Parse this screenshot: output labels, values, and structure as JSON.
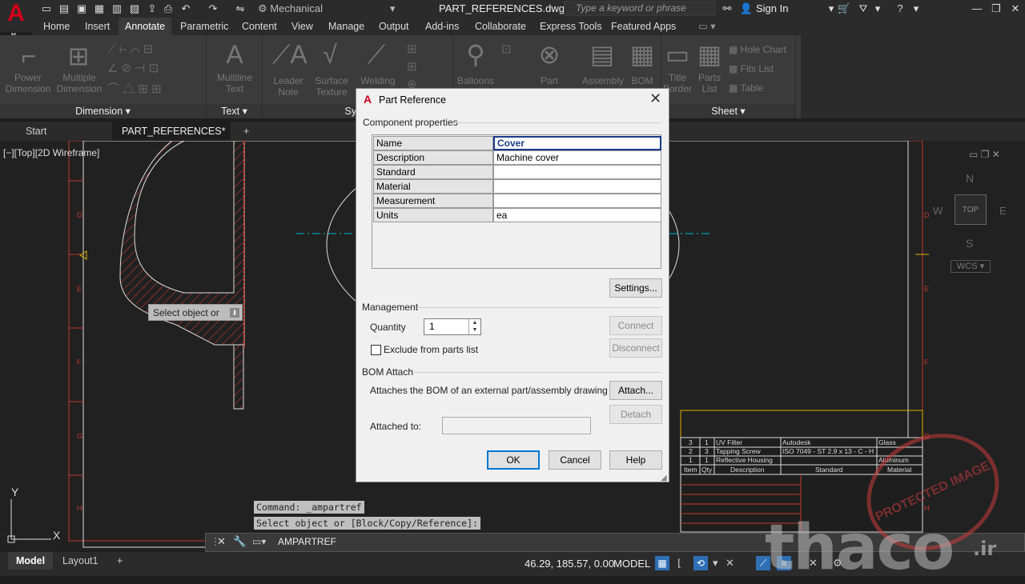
{
  "app": {
    "logo_letter": "A",
    "logo_sub": "M"
  },
  "titlebar": {
    "workspace": "Mechanical",
    "filename": "PART_REFERENCES.dwg",
    "search_placeholder": "Type a keyword or phrase",
    "sign_in": "Sign In"
  },
  "ribbon_tabs": [
    "Home",
    "Insert",
    "Annotate",
    "Parametric",
    "Content",
    "View",
    "Manage",
    "Output",
    "Add-ins",
    "Collaborate",
    "Express Tools",
    "Featured Apps"
  ],
  "ribbon": {
    "power_dimension": "Power\nDimension",
    "multiple_dimension": "Multiple\nDimension",
    "multiline_text": "Multiline\nText",
    "leader_note": "Leader\nNote",
    "surface_texture": "Surface\nTexture",
    "welding": "Welding",
    "balloons": "Balloons",
    "part_reference": "Part",
    "assembly": "Assembly",
    "bom": "BOM",
    "title_border": "Title\nBorder",
    "parts_list": "Parts\nList",
    "hole_chart": "Hole Chart",
    "fits_list": "Fits List",
    "table": "Table",
    "panel_dimension": "Dimension",
    "panel_text": "Text",
    "panel_symbol": "Symb",
    "panel_sheet": "Sheet"
  },
  "doc_tabs": {
    "start": "Start",
    "active": "PART_REFERENCES*"
  },
  "viewport_label": "[−][Top][2D Wireframe]",
  "viewcube": {
    "n": "N",
    "top": "TOP",
    "w": "W",
    "e": "E",
    "s": "S",
    "wcs": "WCS"
  },
  "canvas_tooltip": "Select object or",
  "command_history": [
    "Command: _ampartref",
    "Select object or [Block/Copy/Reference]:"
  ],
  "command_line": "AMPARTREF",
  "dialog": {
    "title": "Part Reference",
    "component_properties": "Component properties",
    "properties": [
      {
        "name": "Name",
        "value": "Cover"
      },
      {
        "name": "Description",
        "value": "Machine cover"
      },
      {
        "name": "Standard",
        "value": ""
      },
      {
        "name": "Material",
        "value": ""
      },
      {
        "name": "Measurement",
        "value": ""
      },
      {
        "name": "Units",
        "value": "ea"
      }
    ],
    "settings": "Settings...",
    "management": "Management",
    "quantity_label": "Quantity",
    "quantity": "1",
    "connect": "Connect",
    "disconnect": "Disconnect",
    "exclude": "Exclude from parts list",
    "bom_attach": "BOM Attach",
    "attach_desc": "Attaches the BOM of an external part/assembly drawing",
    "attach": "Attach...",
    "detach": "Detach",
    "attached_to": "Attached to:",
    "ok": "OK",
    "cancel": "Cancel",
    "help": "Help"
  },
  "parts_list": {
    "rows": [
      {
        "item": "3",
        "qty": "1",
        "desc": "UV Filter",
        "std": "Autodesk",
        "mat": "Glass"
      },
      {
        "item": "2",
        "qty": "3",
        "desc": "Tapping Screw",
        "std": "ISO 7049 - ST 2.9 x 13 - C - H",
        "mat": ""
      },
      {
        "item": "1",
        "qty": "1",
        "desc": "Reflective Housing",
        "std": "",
        "mat": "Aluminum"
      }
    ],
    "header": {
      "item": "Item",
      "qty": "Qty",
      "desc": "Description",
      "std": "Standard",
      "mat": "Material"
    }
  },
  "statusbar": {
    "model_tab": "Model",
    "layout_tab": "Layout1",
    "coords": "46.29, 185.57, 0.00",
    "model": "MODEL"
  },
  "watermark": {
    "text": "thaco",
    "suffix": ".ir",
    "stamp": "PROTECTED IMAGE"
  },
  "colors": {
    "accent": "#d0021b",
    "ribbon_bg": "#3b3b3b",
    "canvas_bg": "#212121",
    "frame_red": "#c0392b",
    "dialog_bg": "#f0f0f0"
  }
}
